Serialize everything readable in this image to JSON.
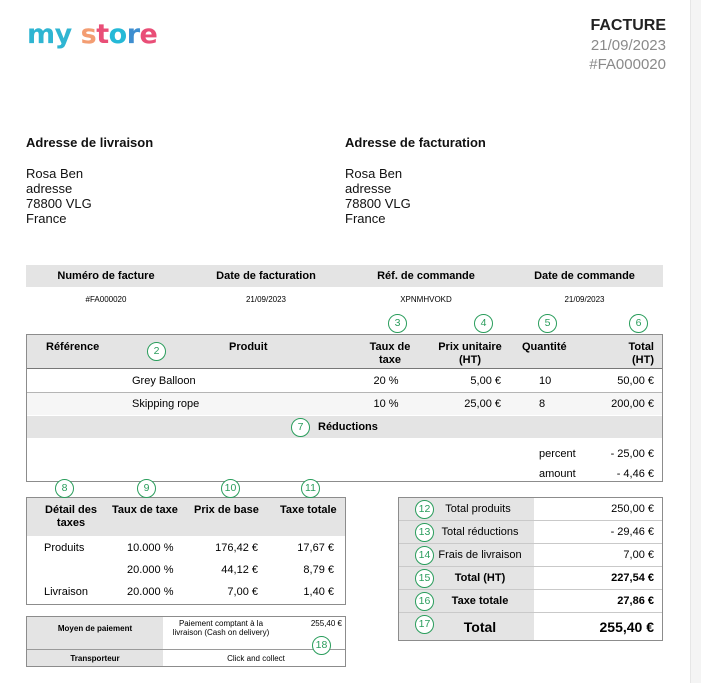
{
  "logo": {
    "text": "my store",
    "letters": [
      {
        "ch": "m",
        "color": "#2fb5d2"
      },
      {
        "ch": "y",
        "color": "#2fb5d2"
      },
      {
        "ch": " ",
        "color": "#2fb5d2"
      },
      {
        "ch": "s",
        "color": "#f39d72"
      },
      {
        "ch": "t",
        "color": "#e94e77"
      },
      {
        "ch": "o",
        "color": "#25b9d7"
      },
      {
        "ch": "r",
        "color": "#3e8ed0"
      },
      {
        "ch": "e",
        "color": "#e94e77"
      }
    ]
  },
  "invoice": {
    "label": "FACTURE",
    "date": "21/09/2023",
    "number": "#FA000020"
  },
  "delivery": {
    "title": "Adresse de livraison",
    "lines": [
      "Rosa Ben",
      "adresse",
      "78800 VLG",
      "France"
    ]
  },
  "billing": {
    "title": "Adresse de facturation",
    "lines": [
      "Rosa Ben",
      "adresse",
      "78800 VLG",
      "France"
    ]
  },
  "info": {
    "headers": [
      "Numéro de facture",
      "Date de facturation",
      "Réf. de commande",
      "Date de commande"
    ],
    "values": [
      "#FA000020",
      "21/09/2023",
      "XPNMHVOKD",
      "21/09/2023"
    ]
  },
  "products": {
    "headers": {
      "reference": "Référence",
      "product": "Produit",
      "tax_rate": "Taux de taxe",
      "unit_price": "Prix unitaire (HT)",
      "quantity": "Quantité",
      "total": "Total (HT)"
    },
    "rows": [
      {
        "reference": "",
        "product": "Grey Balloon",
        "tax_rate": "20 %",
        "unit_price": "5,00 €",
        "quantity": "10",
        "total": "50,00 €"
      },
      {
        "reference": "",
        "product": "Skipping rope",
        "tax_rate": "10 %",
        "unit_price": "25,00 €",
        "quantity": "8",
        "total": "200,00 €"
      }
    ],
    "reductions_label": "Réductions",
    "reductions": [
      {
        "name": "percent",
        "value": "- 25,00 €"
      },
      {
        "name": "amount",
        "value": "- 4,46 €"
      }
    ]
  },
  "tax_detail": {
    "headers": {
      "detail": "Détail des taxes",
      "rate": "Taux de taxe",
      "base": "Prix de base",
      "total": "Taxe totale"
    },
    "rows": [
      {
        "detail": "Produits",
        "rate": "10.000 %",
        "base": "176,42 €",
        "total": "17,67 €"
      },
      {
        "detail": "",
        "rate": "20.000 %",
        "base": "44,12 €",
        "total": "8,79 €"
      },
      {
        "detail": "Livraison",
        "rate": "20.000 %",
        "base": "7,00 €",
        "total": "1,40 €"
      }
    ]
  },
  "totals": {
    "rows": [
      {
        "label": "Total produits",
        "value": "250,00 €"
      },
      {
        "label": "Total réductions",
        "value": "- 29,46 €"
      },
      {
        "label": "Frais de livraison",
        "value": "7,00 €"
      },
      {
        "label": "Total (HT)",
        "value": "227,54 €"
      },
      {
        "label": "Taxe totale",
        "value": "27,86 €"
      },
      {
        "label": "Total",
        "value": "255,40 €"
      }
    ]
  },
  "payment": {
    "method_label": "Moyen de paiement",
    "method_value": "Paiement comptant à la livraison (Cash on delivery)",
    "amount": "255,40 €",
    "carrier_label": "Transporteur",
    "carrier_value": "Click and collect"
  },
  "badges": [
    "2",
    "3",
    "4",
    "5",
    "6",
    "7",
    "8",
    "9",
    "10",
    "11",
    "12",
    "13",
    "14",
    "15",
    "16",
    "17",
    "18"
  ],
  "colors": {
    "badge": "#2a9d5c",
    "header_bg": "#e4e4e4",
    "muted_text": "#8a8a8a"
  }
}
